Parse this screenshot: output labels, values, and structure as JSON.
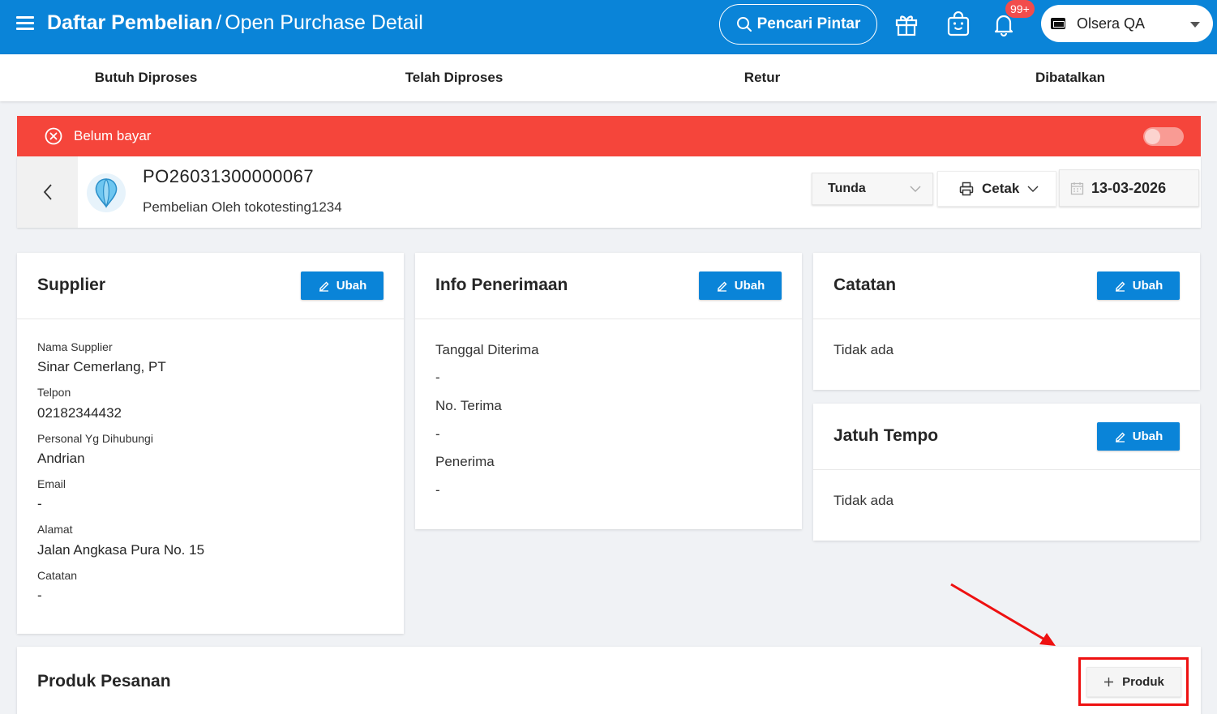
{
  "header": {
    "title_main": "Daftar Pembelian",
    "title_separator": "/",
    "title_sub": "Open Purchase Detail",
    "smart_search_label": "Pencari Pintar",
    "notification_badge": "99+",
    "store_name": "Olsera QA"
  },
  "tabs": [
    {
      "label": "Butuh Diproses"
    },
    {
      "label": "Telah Diproses"
    },
    {
      "label": "Retur"
    },
    {
      "label": "Dibatalkan"
    }
  ],
  "status": {
    "label": "Belum bayar",
    "color": "#f5453b"
  },
  "order": {
    "po_number": "PO26031300000067",
    "subtitle": "Pembelian Oleh tokotesting1234",
    "status_select": "Tunda",
    "print_label": "Cetak",
    "date": "13-03-2026"
  },
  "supplier": {
    "title": "Supplier",
    "edit_label": "Ubah",
    "fields": [
      {
        "label": "Nama Supplier",
        "value": "Sinar Cemerlang, PT"
      },
      {
        "label": "Telpon",
        "value": "02182344432"
      },
      {
        "label": "Personal Yg Dihubungi",
        "value": "Andrian"
      },
      {
        "label": "Email",
        "value": "-"
      },
      {
        "label": "Alamat",
        "value": "Jalan Angkasa Pura No. 15"
      },
      {
        "label": "Catatan",
        "value": "-"
      }
    ]
  },
  "receipt": {
    "title": "Info Penerimaan",
    "edit_label": "Ubah",
    "fields": [
      {
        "label": "Tanggal Diterima",
        "value": "-"
      },
      {
        "label": "No. Terima",
        "value": "-"
      },
      {
        "label": "Penerima",
        "value": "-"
      }
    ]
  },
  "notes": {
    "title": "Catatan",
    "edit_label": "Ubah",
    "value": "Tidak ada"
  },
  "due": {
    "title": "Jatuh Tempo",
    "edit_label": "Ubah",
    "value": "Tidak ada"
  },
  "products": {
    "title": "Produk Pesanan",
    "add_label": "Produk"
  },
  "colors": {
    "primary": "#0a84d8",
    "danger": "#f5453b",
    "annotation": "#ee1111"
  }
}
